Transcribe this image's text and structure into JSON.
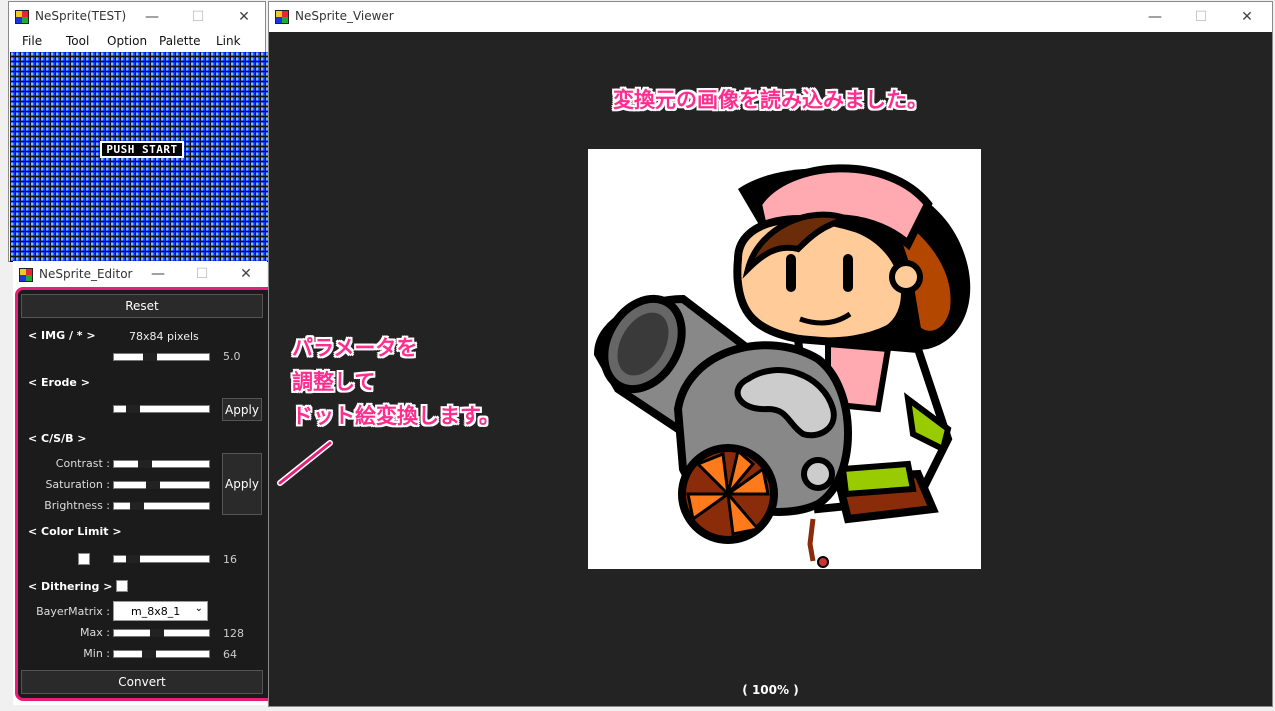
{
  "test_window": {
    "title": "NeSprite(TEST)",
    "menu": [
      "File",
      "Tool",
      "Option",
      "Palette",
      "Link"
    ],
    "screen_text": "PUSH START"
  },
  "editor_window": {
    "title": "NeSprite_Editor",
    "reset_label": "Reset",
    "img_section": "< IMG / * >",
    "img_size": "78x84 pixels",
    "img_scale": "5.0",
    "erode_section": "< Erode >",
    "apply_label": "Apply",
    "csb_section": "< C/S/B >",
    "contrast_label": "Contrast :",
    "saturation_label": "Saturation :",
    "brightness_label": "Brightness :",
    "color_limit_section": "< Color Limit >",
    "color_limit_value": "16",
    "dithering_section": "< Dithering >",
    "bayer_label": "BayerMatrix :",
    "bayer_value": "m_8x8_1",
    "max_label": "Max :",
    "max_value": "128",
    "min_label": "Min :",
    "min_value": "64",
    "convert_label": "Convert",
    "slider_levels": {
      "img_scale": 0.36,
      "erode": 0.15,
      "contrast": 0.3,
      "saturation": 0.4,
      "brightness": 0.2,
      "color_limit": 0.15,
      "max": 0.45,
      "min": 0.35
    }
  },
  "viewer_window": {
    "title": "NeSprite_Viewer",
    "message": "変換元の画像を読み込みました。",
    "zoom": "( 100% )"
  },
  "annotation": {
    "lines": [
      "パラメータを",
      "調整して",
      "ドット絵変換します。"
    ]
  },
  "colors": {
    "accent_pink": "#e81e78",
    "editor_bg": "#1b1b1b",
    "viewer_bg": "#232323",
    "tile_blue": "#0a38ff"
  }
}
